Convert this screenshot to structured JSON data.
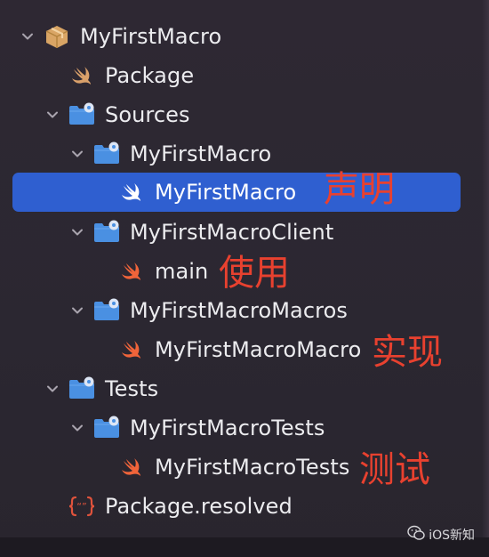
{
  "tree": {
    "project": {
      "label": "MyFirstMacro",
      "icon": "package-box-icon"
    },
    "package": {
      "label": "Package",
      "icon": "swift-icon"
    },
    "sources": {
      "label": "Sources",
      "icon": "folder-gear-icon"
    },
    "sources_macro": {
      "label": "MyFirstMacro",
      "icon": "folder-gear-icon"
    },
    "sources_macro_file": {
      "label": "MyFirstMacro",
      "icon": "swift-icon",
      "selected": true
    },
    "client": {
      "label": "MyFirstMacroClient",
      "icon": "folder-gear-icon"
    },
    "client_main": {
      "label": "main",
      "icon": "swift-icon"
    },
    "macros": {
      "label": "MyFirstMacroMacros",
      "icon": "folder-gear-icon"
    },
    "macros_file": {
      "label": "MyFirstMacroMacro",
      "icon": "swift-icon"
    },
    "tests": {
      "label": "Tests",
      "icon": "folder-gear-icon"
    },
    "tests_folder": {
      "label": "MyFirstMacroTests",
      "icon": "folder-gear-icon"
    },
    "tests_file": {
      "label": "MyFirstMacroTests",
      "icon": "swift-icon"
    },
    "resolved": {
      "label": "Package.resolved",
      "icon": "json-braces-icon"
    }
  },
  "annotations": {
    "declaration": "声明",
    "usage": "使用",
    "implementation": "实现",
    "testing": "测试"
  },
  "watermark": {
    "text": "iOS新知"
  },
  "colors": {
    "background": "#2a2630",
    "selection": "#2f5fd0",
    "annotation": "#e8412f",
    "swift": "#f0643a",
    "folder": "#4a90e2"
  }
}
